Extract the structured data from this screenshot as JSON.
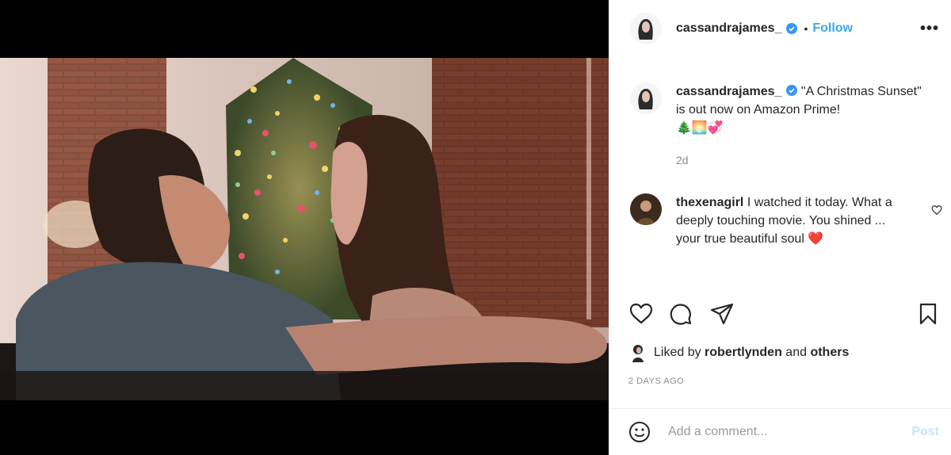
{
  "post": {
    "username": "cassandrajames_",
    "separator": "•",
    "follow_label": "Follow",
    "more_label": "•••",
    "media_icon": "video-still",
    "caption_text": "\"A Christmas Sunset\" is out now on Amazon Prime!",
    "caption_emojis": "🎄🌅💞",
    "caption_time": "2d"
  },
  "comments": [
    {
      "username": "thexenagirl",
      "text": "I watched it today. What a deeply touching movie. You shined ... your true beautiful soul",
      "emoji": "❤️"
    }
  ],
  "actions": {
    "like_icon": "heart-icon",
    "comment_icon": "comment-bubble-icon",
    "share_icon": "paper-plane-icon",
    "save_icon": "bookmark-icon"
  },
  "likes": {
    "prefix": "Liked by",
    "user": "robertlynden",
    "connector": "and",
    "others": "others"
  },
  "timestamp": "2 days ago",
  "add_comment": {
    "placeholder": "Add a comment...",
    "post_label": "Post"
  },
  "colors": {
    "accent": "#3aa7ee",
    "verified": "#3897f0",
    "post_disabled": "#c7e3f8",
    "muted": "#8e8e8e"
  }
}
